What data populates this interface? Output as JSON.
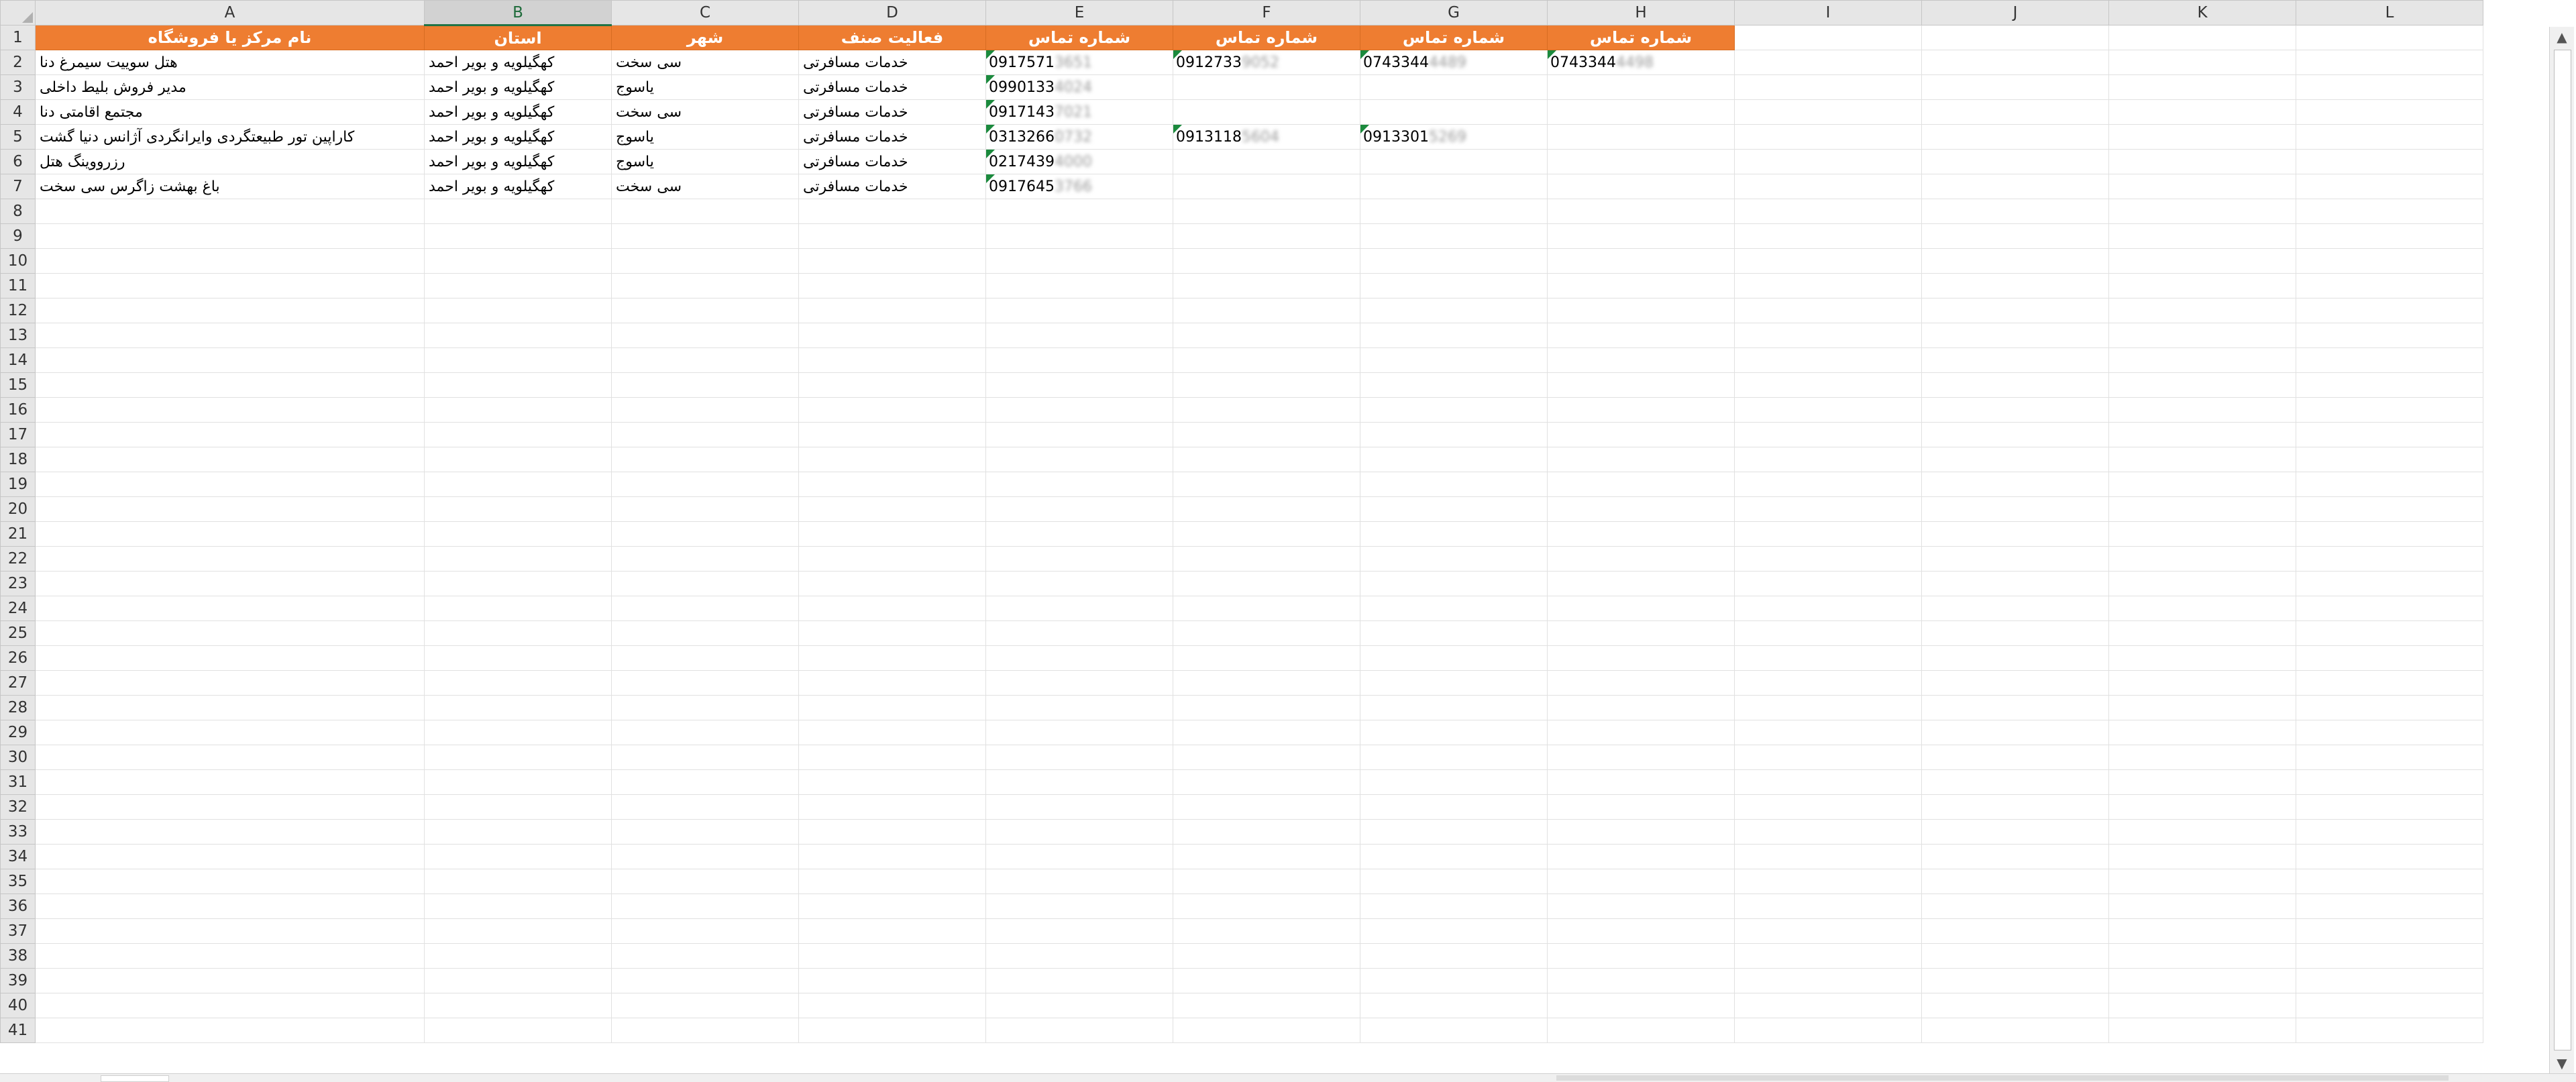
{
  "columns": [
    "A",
    "B",
    "C",
    "D",
    "E",
    "F",
    "G",
    "H",
    "I",
    "J",
    "K",
    "L"
  ],
  "selected_column": "B",
  "header_row": [
    "نام مرکز یا فروشگاه",
    "استان",
    "شهر",
    "فعالیت صنف",
    "شماره تماس",
    "شماره تماس",
    "شماره تماس",
    "شماره تماس"
  ],
  "rows": [
    {
      "name": "هتل سوییت سیمرغ دنا",
      "province": "کهگیلویه و بویر احمد",
      "city": "سی سخت",
      "activity": "خدمات مسافرتی",
      "phones": [
        {
          "v": "0917571",
          "h": "3651"
        },
        {
          "v": "0912733",
          "h": "9052"
        },
        {
          "v": "0743344",
          "h": "4489"
        },
        {
          "v": "0743344",
          "h": "4498"
        }
      ]
    },
    {
      "name": "مدیر فروش بلیط داخلی",
      "province": "کهگیلویه و بویر احمد",
      "city": "یاسوج",
      "activity": "خدمات مسافرتی",
      "phones": [
        {
          "v": "0990133",
          "h": "4024"
        }
      ]
    },
    {
      "name": "مجتمع اقامتی دنا",
      "province": "کهگیلویه و بویر احمد",
      "city": "سی سخت",
      "activity": "خدمات مسافرتی",
      "phones": [
        {
          "v": "0917143",
          "h": "7021"
        }
      ]
    },
    {
      "name": "کاراپین تور طبیعتگردی وایرانگردی آژانس دنیا گشت",
      "province": "کهگیلویه و بویر احمد",
      "city": "یاسوج",
      "activity": "خدمات مسافرتی",
      "phones": [
        {
          "v": "0313266",
          "h": "0732"
        },
        {
          "v": "0913118",
          "h": "5604"
        },
        {
          "v": "0913301",
          "h": "5269"
        }
      ]
    },
    {
      "name": "رزرووینگ هتل",
      "province": "کهگیلویه و بویر احمد",
      "city": "یاسوج",
      "activity": "خدمات مسافرتی",
      "phones": [
        {
          "v": "0217439",
          "h": "4000"
        }
      ]
    },
    {
      "name": "باغ بهشت زاگرس سی سخت",
      "province": "کهگیلویه و بویر احمد",
      "city": "سی سخت",
      "activity": "خدمات مسافرتی",
      "phones": [
        {
          "v": "0917645",
          "h": "3766"
        }
      ]
    }
  ],
  "row_count": 41,
  "colors": {
    "header_fill": "#ee7d31",
    "header_text": "#ffffff",
    "grid": "#e1e1e1",
    "chrome": "#e6e6e6",
    "select": "#217346"
  },
  "icons": {
    "scroll_up": "scroll-up-arrow-icon",
    "scroll_down": "scroll-down-arrow-icon",
    "select_all": "select-all-triangle-icon"
  },
  "scroll_up_glyph": "▲",
  "scroll_down_glyph": "▼"
}
